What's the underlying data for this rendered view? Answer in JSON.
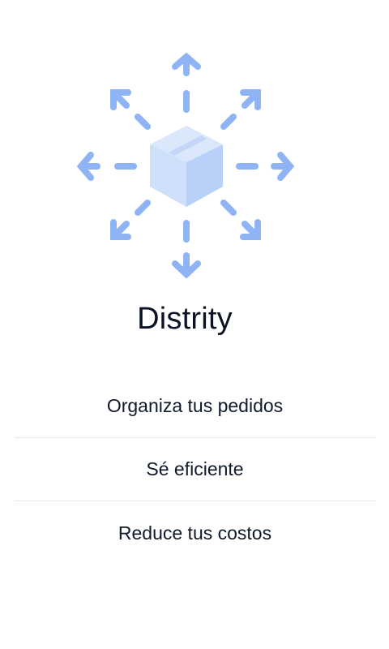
{
  "app": {
    "title": "Distrity",
    "logo_icon": "box-with-arrows-icon",
    "accent_color": "#8fb4f5",
    "box_color": "#cfe0fb"
  },
  "features": {
    "items": [
      {
        "label": "Organiza tus pedidos"
      },
      {
        "label": "Sé eficiente"
      },
      {
        "label": "Reduce tus costos"
      }
    ]
  }
}
